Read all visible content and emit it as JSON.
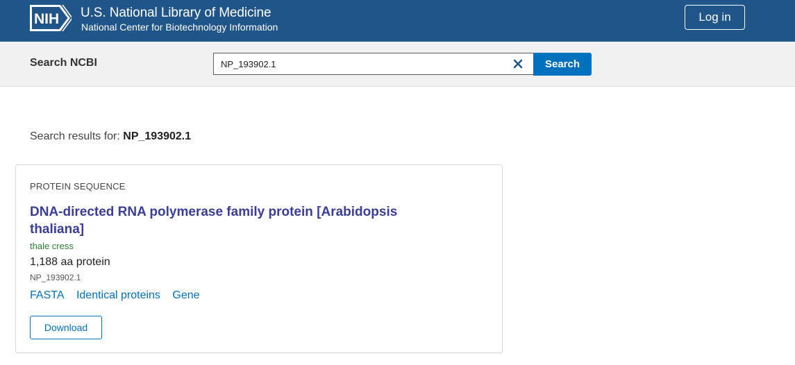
{
  "header": {
    "logo_text": "NIH",
    "title": "U.S. National Library of Medicine",
    "subtitle": "National Center for Biotechnology Information",
    "login_label": "Log in",
    "background_color": "#20558a"
  },
  "search": {
    "label": "Search NCBI",
    "value": "NP_193902.1",
    "button_label": "Search",
    "button_color": "#0071bc"
  },
  "results": {
    "prefix": "Search results for: ",
    "query": "NP_193902.1"
  },
  "card": {
    "type": "PROTEIN SEQUENCE",
    "title": "DNA-directed RNA polymerase family protein [Arabidopsis thaliana]",
    "organism": "thale cress",
    "length": "1,188 aa protein",
    "accession": "NP_193902.1",
    "links": [
      "FASTA",
      "Identical proteins",
      "Gene"
    ],
    "download_label": "Download"
  }
}
